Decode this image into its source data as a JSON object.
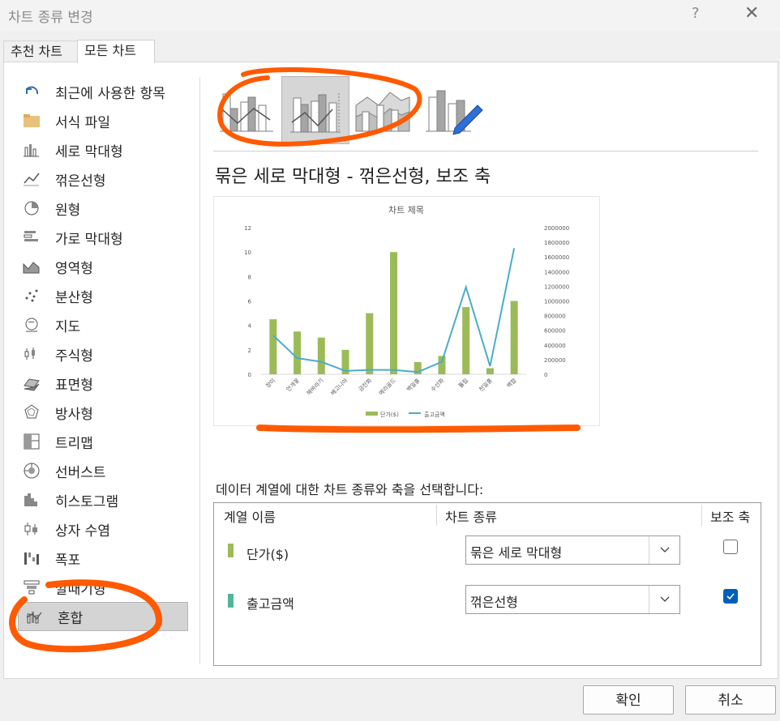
{
  "window": {
    "title": "차트 종류 변경",
    "help": "?",
    "close": "✕"
  },
  "tabs": [
    {
      "label": "추천 차트"
    },
    {
      "label": "모든 차트"
    }
  ],
  "sidebar": {
    "items": [
      {
        "label": "최근에 사용한 항목",
        "icon": "recent-icon"
      },
      {
        "label": "서식 파일",
        "icon": "folder-icon"
      },
      {
        "label": "세로 막대형",
        "icon": "column-chart-icon"
      },
      {
        "label": "꺾은선형",
        "icon": "line-chart-icon"
      },
      {
        "label": "원형",
        "icon": "pie-chart-icon"
      },
      {
        "label": "가로 막대형",
        "icon": "bar-chart-icon"
      },
      {
        "label": "영역형",
        "icon": "area-chart-icon"
      },
      {
        "label": "분산형",
        "icon": "scatter-chart-icon"
      },
      {
        "label": "지도",
        "icon": "map-chart-icon"
      },
      {
        "label": "주식형",
        "icon": "stock-chart-icon"
      },
      {
        "label": "표면형",
        "icon": "surface-chart-icon"
      },
      {
        "label": "방사형",
        "icon": "radar-chart-icon"
      },
      {
        "label": "트리맵",
        "icon": "treemap-chart-icon"
      },
      {
        "label": "선버스트",
        "icon": "sunburst-chart-icon"
      },
      {
        "label": "히스토그램",
        "icon": "histogram-chart-icon"
      },
      {
        "label": "상자 수염",
        "icon": "boxwhisker-chart-icon"
      },
      {
        "label": "폭포",
        "icon": "waterfall-chart-icon"
      },
      {
        "label": "깔때기형",
        "icon": "funnel-chart-icon"
      },
      {
        "label": "혼합",
        "icon": "combo-chart-icon"
      }
    ],
    "selected_index": 18
  },
  "subtypes": [
    {
      "icon": "clustered-column-line-icon"
    },
    {
      "icon": "clustered-column-line-secondary-axis-icon",
      "selected": true
    },
    {
      "icon": "stacked-area-clustered-column-icon"
    },
    {
      "icon": "custom-combination-icon"
    }
  ],
  "heading": "묶은 세로 막대형 - 꺾은선형, 보조 축",
  "chart_data": {
    "type": "bar",
    "title": "차트 제목",
    "categories": [
      "장미",
      "안개꽃",
      "해바라기",
      "베고니아",
      "금잔화",
      "메리골드",
      "백일홍",
      "수선화",
      "튤립",
      "천일홍",
      "백합"
    ],
    "series": [
      {
        "name": "단가($)",
        "type": "bar",
        "axis": "primary",
        "values": [
          4.5,
          3.5,
          3,
          2,
          5,
          10,
          1,
          1.5,
          5.5,
          0.5,
          6
        ]
      },
      {
        "name": "출고금액",
        "type": "line",
        "axis": "secondary",
        "values": [
          530000,
          220000,
          170000,
          45000,
          60000,
          60000,
          30000,
          170000,
          1190000,
          110000,
          1720000
        ]
      }
    ],
    "ylim": [
      0,
      12
    ],
    "yticks": [
      "0",
      "2",
      "4",
      "6",
      "8",
      "10",
      "12"
    ],
    "y2lim": [
      0,
      2000000
    ],
    "y2ticks": [
      "0",
      "200000",
      "400000",
      "600000",
      "800000",
      "1000000",
      "1200000",
      "1400000",
      "1600000",
      "1800000",
      "2000000"
    ],
    "legend": "bottom",
    "grid": false,
    "colors": {
      "bar": "#9bbb59",
      "line": "#4bacc6"
    }
  },
  "series_panel": {
    "instruction": "데이터 계열에 대한 차트 종류와 축을 선택합니다:",
    "headers": {
      "name": "계열 이름",
      "type": "차트 종류",
      "axis": "보조 축"
    },
    "rows": [
      {
        "name": "단가($)",
        "color": "#9bbb59",
        "chart_type": "묶은 세로 막대형",
        "secondary": false
      },
      {
        "name": "출고금액",
        "color": "#4fb69c",
        "chart_type": "꺾은선형",
        "secondary": true
      }
    ]
  },
  "buttons": {
    "ok": "확인",
    "cancel": "취소"
  },
  "colors": {
    "accent": "#005fb8",
    "annotation": "#ff5a00"
  }
}
